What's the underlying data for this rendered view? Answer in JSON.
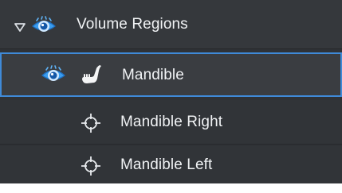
{
  "tree": {
    "root": {
      "label": "Volume Regions",
      "expanded": true,
      "visible": true
    },
    "items": [
      {
        "label": "Mandible",
        "visible": true,
        "selected": true,
        "icon": "mandible-icon"
      },
      {
        "label": "Mandible Right",
        "icon": "crosshair-point-icon"
      },
      {
        "label": "Mandible Left",
        "icon": "crosshair-point-icon"
      }
    ]
  },
  "colors": {
    "panel_bg": "#2f3236",
    "selection_border": "#3f8ad8",
    "eye_blue": "#2f8fe0",
    "text": "#f1f3f5"
  }
}
